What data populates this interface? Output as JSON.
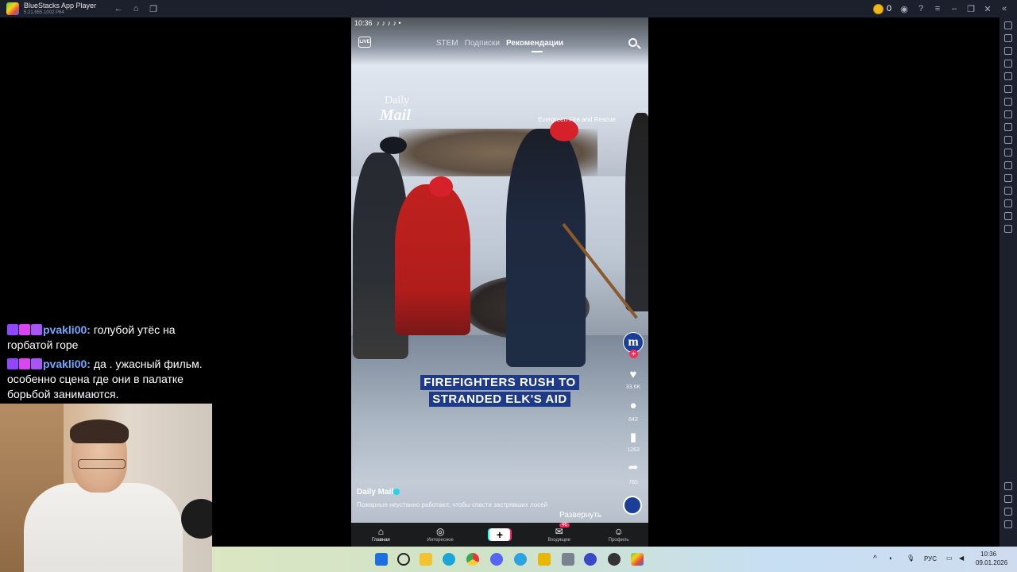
{
  "titlebar": {
    "title": "BlueStacks App Player",
    "version": "5.21.655.1002 P64",
    "coins": "0"
  },
  "phone": {
    "status_time": "10:36",
    "live_label": "LIVE",
    "tabs": [
      "STEM",
      "Подписки",
      "Рекомендации"
    ],
    "active_tab": "Рекомендации",
    "watermark_top": "Daily",
    "watermark_bottom": "Mail",
    "credit": "Evergreen Fire and Rescue",
    "caption_line1": "FIREFIGHTERS RUSH TO",
    "caption_line2": "STRANDED ELK'S AID",
    "avatar_letter": "m",
    "likes": "33.6K",
    "comments": "642",
    "saves": "1263",
    "shares": "765",
    "author": "Daily Mail",
    "description": "Пожарные неустанно работают, чтобы спасти застрявших лосей",
    "expand_label": "Развернуть",
    "nav": [
      {
        "label": "Главная",
        "icon": "⌂"
      },
      {
        "label": "Интересное",
        "icon": "◎"
      },
      {
        "label": "",
        "icon": "+"
      },
      {
        "label": "Входящие",
        "icon": "✉"
      },
      {
        "label": "Профиль",
        "icon": "☺"
      }
    ],
    "inbox_count": "46"
  },
  "chat": [
    {
      "user": "pvakli00:",
      "text": "голубой утёс на горбатой горе"
    },
    {
      "user": "pvakli00:",
      "text": "да . ужасный фильм. особенно сцена где они в палатке борьбой занимаются."
    }
  ],
  "taskbar": {
    "lang": "РУС",
    "time": "10:36",
    "date": "09.01.2026"
  },
  "colors": {
    "titlebar_bg": "#1c1f2c",
    "caption_bg": "#1e3a8a",
    "tiktok_pink": "#fe2c55",
    "tiktok_cyan": "#25f4ee",
    "chat_user": "#6ea8ff"
  }
}
